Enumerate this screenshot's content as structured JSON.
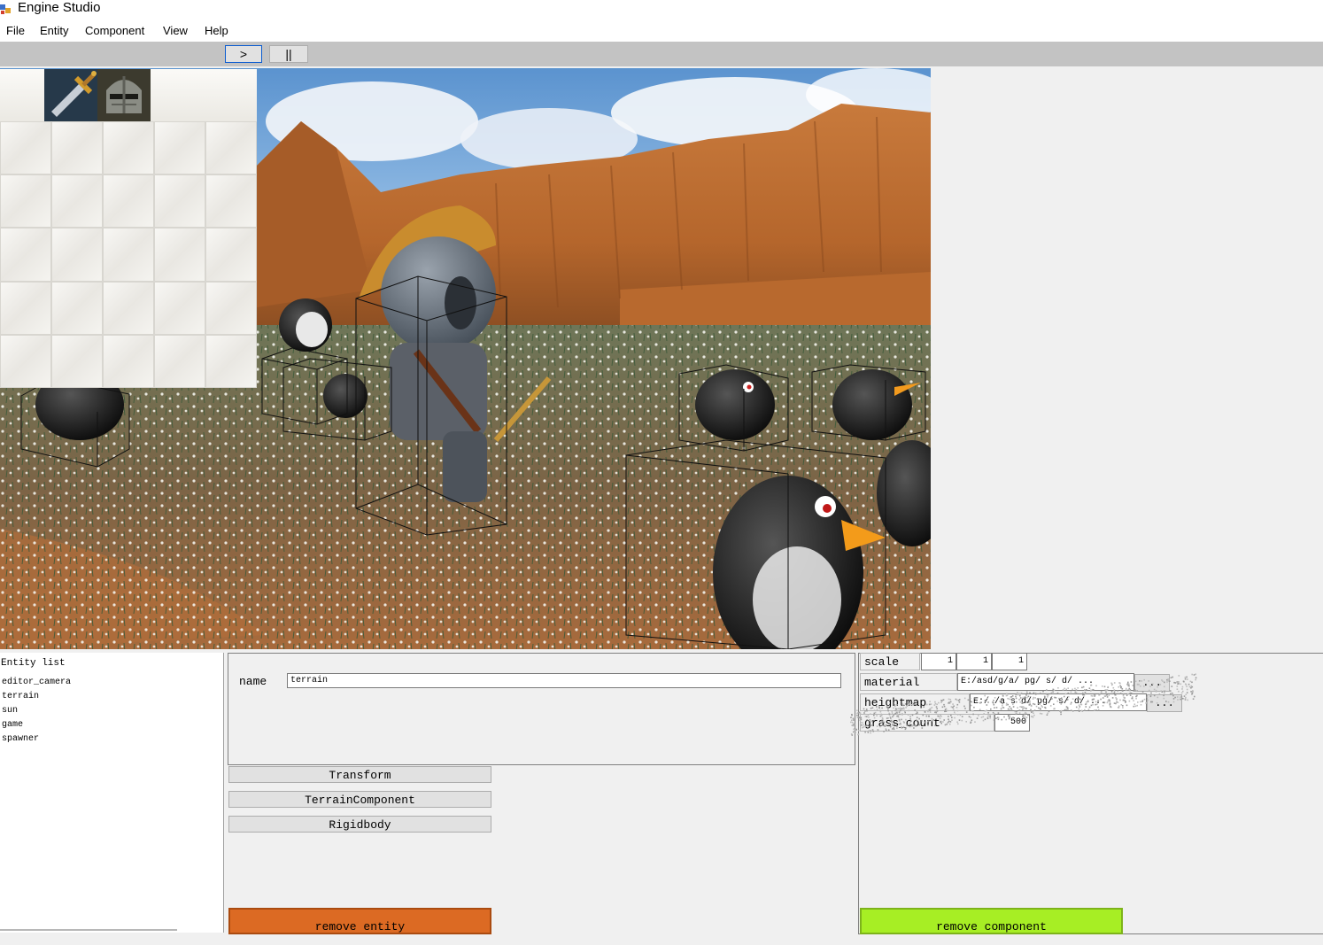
{
  "window": {
    "title": "Engine Studio"
  },
  "menu": [
    "File",
    "Entity",
    "Component",
    "View",
    "Help"
  ],
  "toolbar": {
    "play_label": ">",
    "pause_label": "||"
  },
  "inventory": {
    "items": [
      "sword-icon",
      "helmet-icon"
    ],
    "rows": 5,
    "cols": 5
  },
  "entity_list": {
    "header": "Entity list",
    "items": [
      "editor_camera",
      "terrain",
      "sun",
      "game",
      "spawner"
    ]
  },
  "properties": {
    "name_label": "name",
    "name_value": "terrain",
    "components": [
      "Transform",
      "TerrainComponent",
      "Rigidbody"
    ],
    "remove_entity_label": "remove entity"
  },
  "component": {
    "scale_label": "scale",
    "scale_values": [
      "1",
      "1",
      "1"
    ],
    "material_label": "material",
    "material_value": "E:/asd/g/a/ pg/ s/ d/ ...",
    "heightmap_label": "heightmap",
    "heightmap_value": "E:/ /a s d/ pg/ s/ d/ ...",
    "grass_label": "grass_count",
    "grass_value": "500",
    "browse_label": "...",
    "remove_component_label": "remove component"
  },
  "colors": {
    "remove_entity_bg": "#dc6a23",
    "remove_component_bg": "#a7ee24",
    "toolbar_bg": "#c3c3c3",
    "sky": "#6fa3d6",
    "canyon": "#c8773a",
    "grass": "#5d6a4a"
  }
}
